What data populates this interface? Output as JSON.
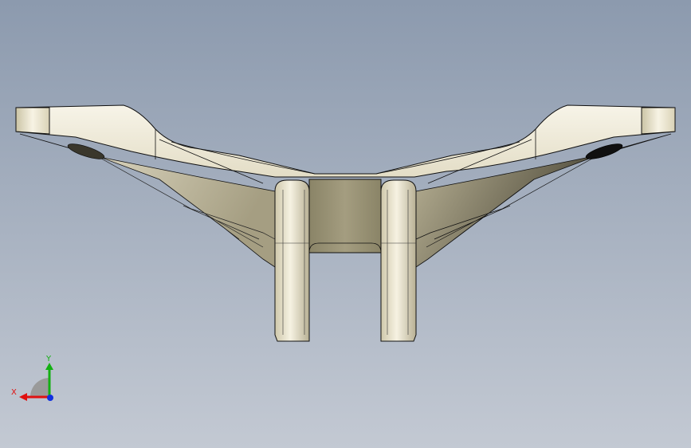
{
  "viewport": {
    "colors": {
      "background_top": "#8c9aae",
      "background_bottom": "#c3c9d3",
      "part_light": "#f3efdf",
      "part_mid": "#d9d2b6",
      "part_dark": "#2a2820",
      "edge": "#111111"
    }
  },
  "triad": {
    "x_label": "X",
    "y_label": "Y",
    "colors": {
      "x_axis": "#e01010",
      "y_axis": "#12b012",
      "z_axis": "#1030e0",
      "shade": "#9a9a9a"
    }
  }
}
